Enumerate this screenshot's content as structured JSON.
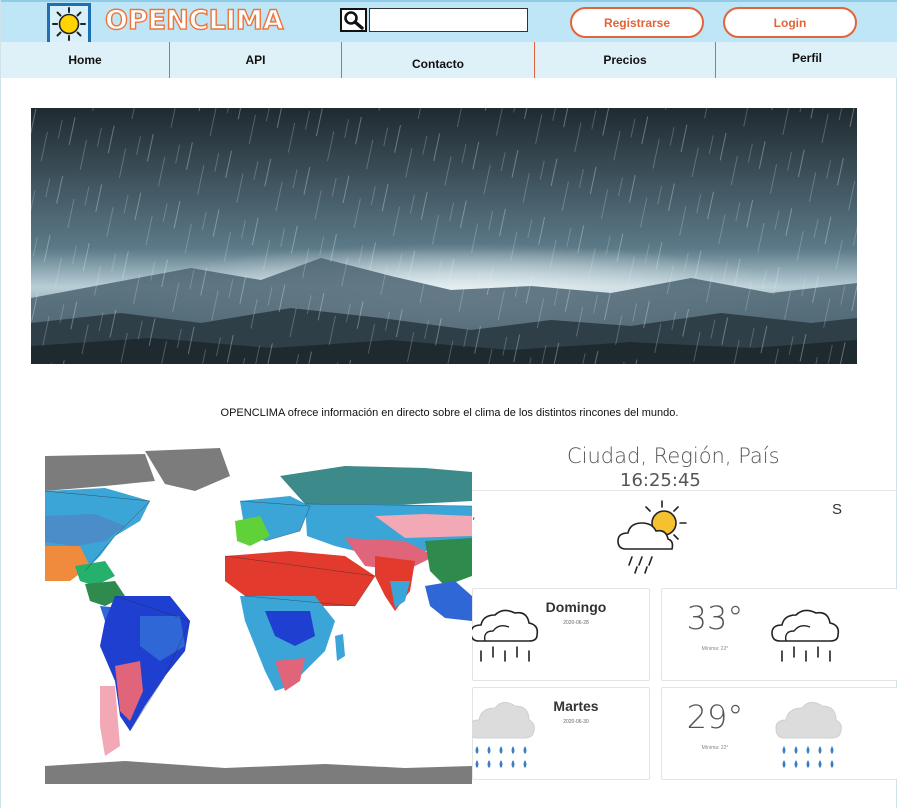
{
  "header": {
    "brand": "OPENCLIMA",
    "search": {
      "placeholder": "",
      "value": ""
    },
    "register_label": "Registrarse",
    "login_label": "Login"
  },
  "nav": {
    "items": [
      {
        "label": "Home"
      },
      {
        "label": "API"
      },
      {
        "label": "Contacto"
      },
      {
        "label": "Precios"
      },
      {
        "label": "Perfil"
      }
    ]
  },
  "intro": "OPENCLIMA ofrece información en directo sobre el clima de los distintos rincones del mundo.",
  "weather": {
    "location": "Ciudad, Región, País",
    "time": "16:25:45",
    "right_edge_letter": "S",
    "forecast": [
      {
        "day": "Domingo",
        "date": "2020-06-28",
        "temp": "33°",
        "min": "Mínima: 22°",
        "icon": "rain-cloud-icon"
      },
      {
        "day": "Martes",
        "date": "2020-06-30",
        "temp": "29°",
        "min": "Mínima: 22°",
        "icon": "rain-drops-cloud-icon"
      }
    ],
    "current_icon": "partly-cloudy-rain-icon"
  },
  "colors": {
    "topbar": "#bfe6f6",
    "navbar": "#dff1f8",
    "accent": "#e2643a",
    "logo_border": "#1e6fb3"
  }
}
